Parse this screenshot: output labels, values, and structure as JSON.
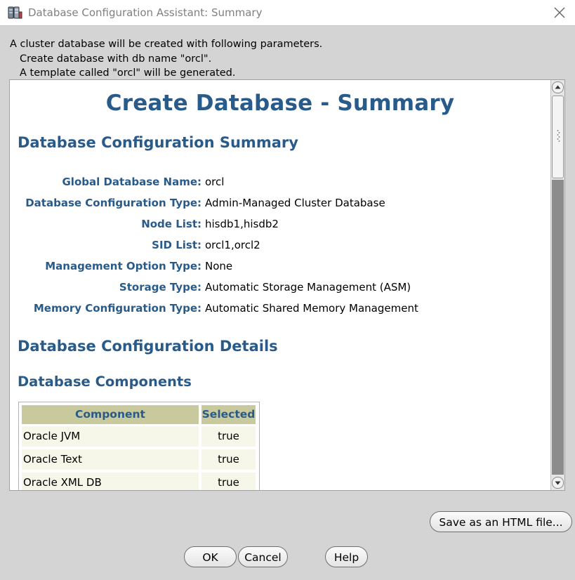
{
  "window": {
    "title": "Database Configuration Assistant: Summary"
  },
  "intro": {
    "line1": "A cluster database will be created with following parameters.",
    "line2": "Create database with db name \"orcl\".",
    "line3": "A template called \"orcl\" will be generated."
  },
  "report": {
    "title": "Create Database - Summary",
    "summary_heading": "Database Configuration Summary",
    "summary": [
      {
        "label": "Global Database Name:",
        "value": "orcl"
      },
      {
        "label": "Database Configuration Type:",
        "value": "Admin-Managed Cluster Database"
      },
      {
        "label": "Node List:",
        "value": "hisdb1,hisdb2"
      },
      {
        "label": "SID List:",
        "value": "orcl1,orcl2"
      },
      {
        "label": "Management Option Type:",
        "value": "None"
      },
      {
        "label": "Storage Type:",
        "value": "Automatic Storage Management (ASM)"
      },
      {
        "label": "Memory Configuration Type:",
        "value": "Automatic Shared Memory Management"
      }
    ],
    "details_heading": "Database Configuration Details",
    "components_heading": "Database Components",
    "components_table": {
      "headers": {
        "component": "Component",
        "selected": "Selected"
      },
      "rows": [
        {
          "component": "Oracle JVM",
          "selected": "true"
        },
        {
          "component": "Oracle Text",
          "selected": "true"
        },
        {
          "component": "Oracle XML DB",
          "selected": "true"
        }
      ]
    }
  },
  "buttons": {
    "save_html": "Save as an HTML file...",
    "ok": "OK",
    "cancel": "Cancel",
    "help": "Help"
  },
  "colors": {
    "heading_blue": "#295b8a",
    "table_header": "#c9c99e",
    "table_cell": "#f6f6e9",
    "dialog_bg": "#d4d4d4"
  },
  "icons": {
    "app": "database-app-icon",
    "close": "close-icon"
  }
}
